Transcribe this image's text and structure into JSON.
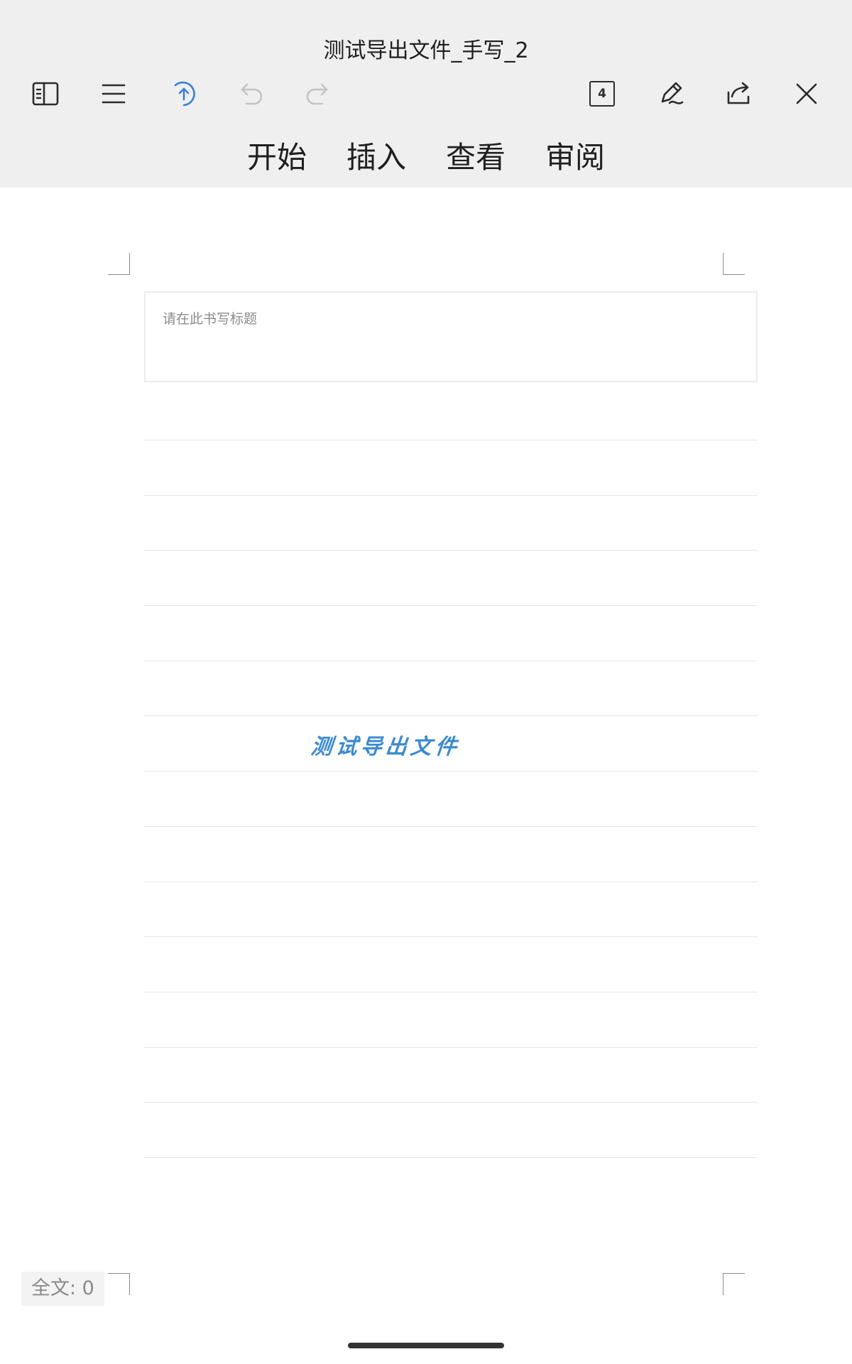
{
  "header": {
    "title": "测试导出文件_手写_2",
    "page_count": "4",
    "toolbar_icons": {
      "left": [
        "sidebar-toggle-icon",
        "menu-icon",
        "sync-upload-icon",
        "undo-icon",
        "redo-icon"
      ],
      "right": [
        "page-count-icon",
        "pen-edit-icon",
        "share-icon",
        "close-icon"
      ]
    },
    "colors": {
      "background": "#efefef",
      "accent": "#3b7fd9",
      "disabled": "#c4c4c4"
    },
    "tabs": [
      {
        "label": "开始"
      },
      {
        "label": "插入"
      },
      {
        "label": "查看"
      },
      {
        "label": "审阅"
      }
    ]
  },
  "document": {
    "title_placeholder": "请在此书写标题",
    "handwritten_text": "测试导出文件",
    "handwriting_color": "#3c8ad0"
  },
  "status": {
    "word_count": "全文: 0"
  }
}
